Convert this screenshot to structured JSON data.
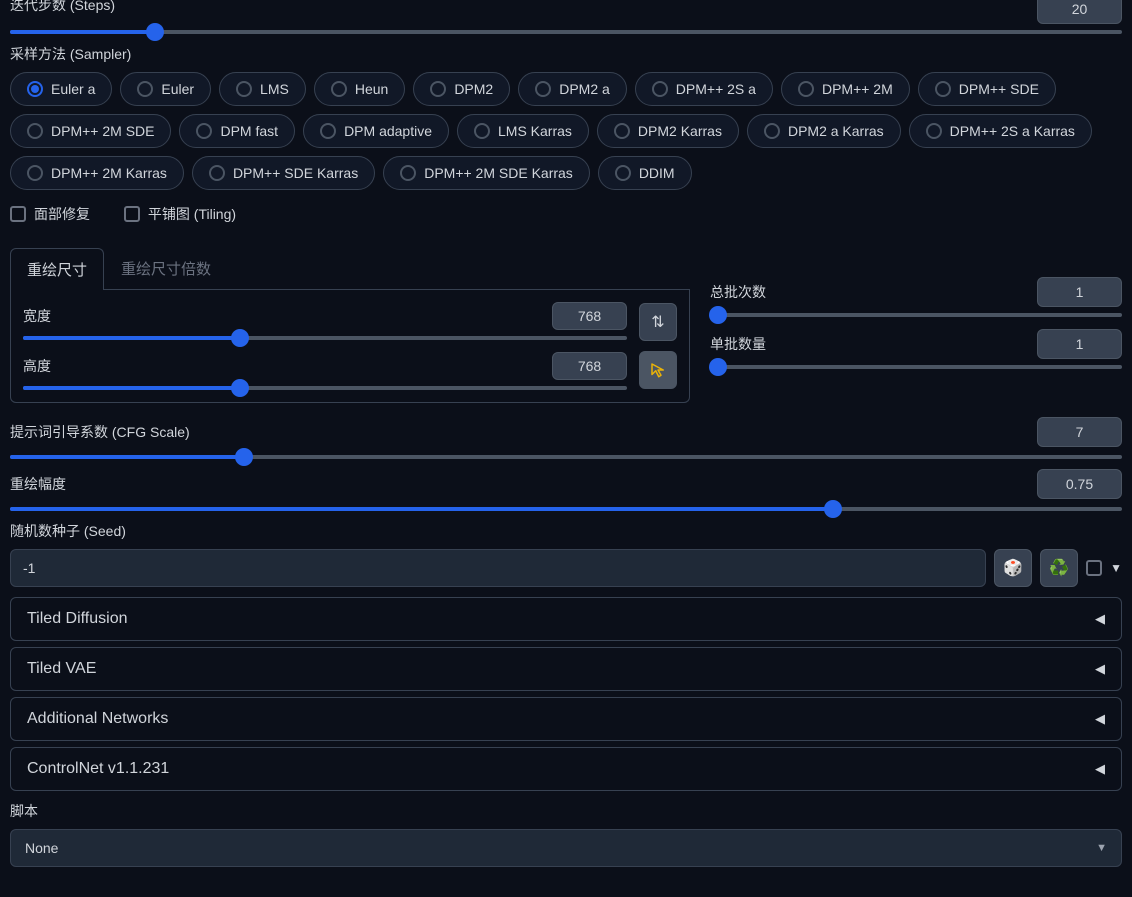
{
  "steps": {
    "label": "迭代步数 (Steps)",
    "value": "20",
    "fill": 13
  },
  "sampler": {
    "label": "采样方法 (Sampler)",
    "selected": 0,
    "options": [
      "Euler a",
      "Euler",
      "LMS",
      "Heun",
      "DPM2",
      "DPM2 a",
      "DPM++ 2S a",
      "DPM++ 2M",
      "DPM++ SDE",
      "DPM++ 2M SDE",
      "DPM fast",
      "DPM adaptive",
      "LMS Karras",
      "DPM2 Karras",
      "DPM2 a Karras",
      "DPM++ 2S a Karras",
      "DPM++ 2M Karras",
      "DPM++ SDE Karras",
      "DPM++ 2M SDE Karras",
      "DDIM"
    ]
  },
  "checks": {
    "face": "面部修复",
    "tiling": "平铺图 (Tiling)"
  },
  "tabs": {
    "resize": "重绘尺寸",
    "resize_by": "重绘尺寸倍数"
  },
  "width": {
    "label": "宽度",
    "value": "768",
    "fill": 36
  },
  "height": {
    "label": "高度",
    "value": "768",
    "fill": 36
  },
  "swap_icon": "⇅",
  "target_icon": "↖",
  "batch_count": {
    "label": "总批次数",
    "value": "1",
    "fill": 2
  },
  "batch_size": {
    "label": "单批数量",
    "value": "1",
    "fill": 2
  },
  "cfg": {
    "label": "提示词引导系数 (CFG Scale)",
    "value": "7",
    "fill": 21
  },
  "denoise": {
    "label": "重绘幅度",
    "value": "0.75",
    "fill": 74
  },
  "seed": {
    "label": "随机数种子 (Seed)",
    "value": "-1",
    "dice": "🎲",
    "recycle": "♻️"
  },
  "extra_arrow": "▼",
  "accordions": {
    "td": "Tiled Diffusion",
    "tv": "Tiled VAE",
    "an": "Additional Networks",
    "cn": "ControlNet v1.1.231"
  },
  "arr": "◀",
  "script": {
    "label": "脚本",
    "value": "None"
  }
}
